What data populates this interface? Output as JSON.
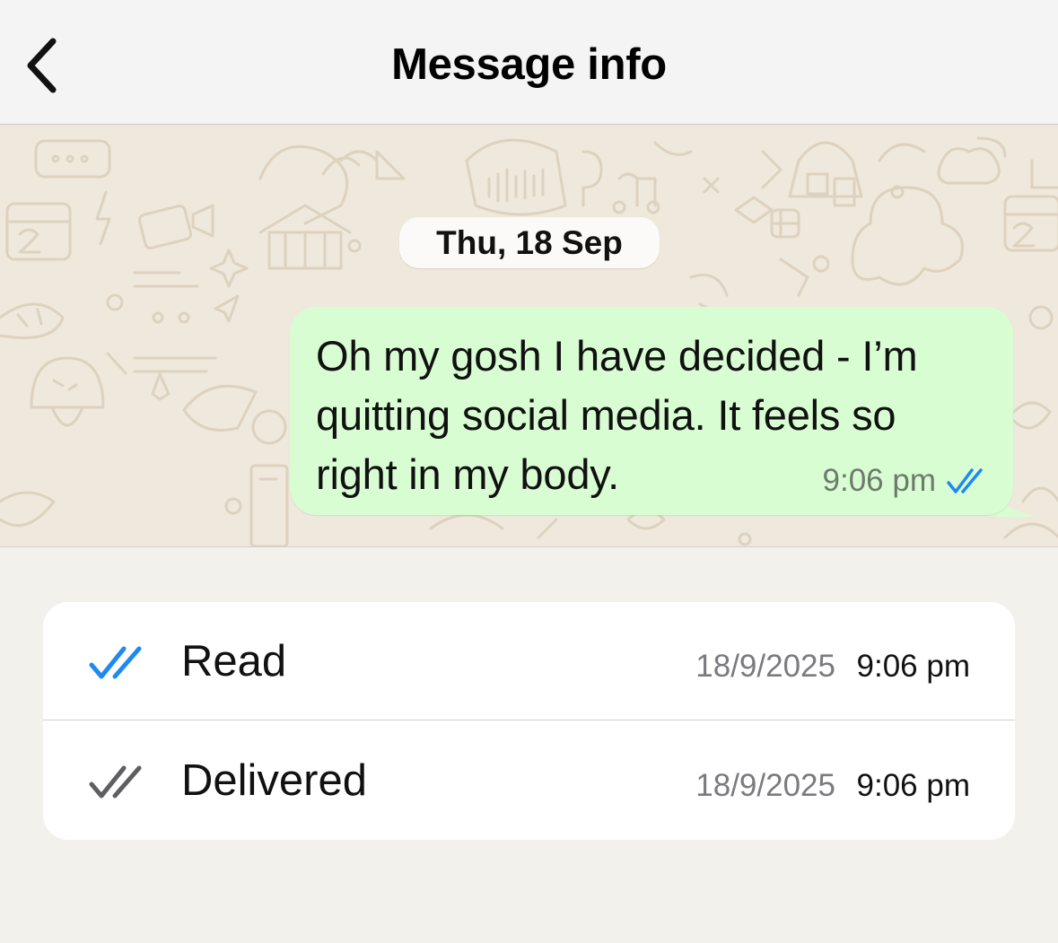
{
  "header": {
    "title": "Message info",
    "back_icon": "chevron-left-icon"
  },
  "chat": {
    "date_label": "Thu, 18 Sep",
    "message": {
      "text": "Oh my gosh I have decided - I’m quitting social media. It feels so right in my body.",
      "time": "9:06 pm",
      "status_icon": "double-check-icon",
      "status_color": "#1d8af2",
      "bubble_color": "#d9fdd3"
    }
  },
  "status": {
    "rows": [
      {
        "label": "Read",
        "date": "18/9/2025",
        "time": "9:06 pm",
        "icon": "double-check-blue-icon",
        "icon_color": "#1d8af2"
      },
      {
        "label": "Delivered",
        "date": "18/9/2025",
        "time": "9:06 pm",
        "icon": "double-check-grey-icon",
        "icon_color": "#5f5f63"
      }
    ]
  }
}
